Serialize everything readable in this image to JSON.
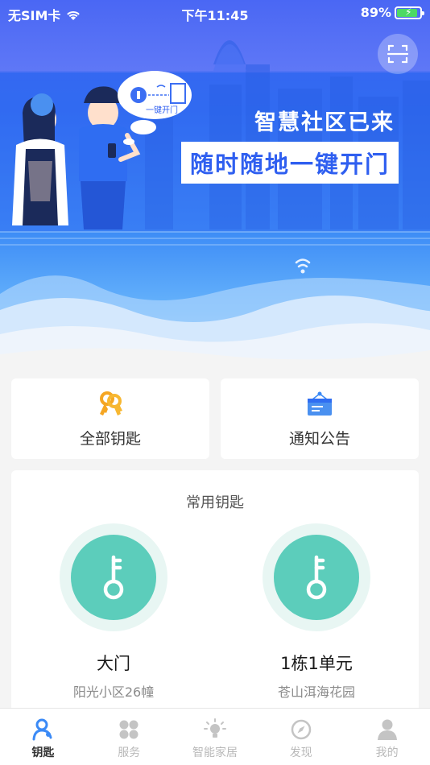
{
  "status_bar": {
    "carrier": "无SIM卡",
    "time": "下午11:45",
    "battery": "89%",
    "battery_level": 0.89
  },
  "hero": {
    "slogan_line1": "智慧社区已来",
    "slogan_line2": "随时随地一键开门",
    "bubble_text": "一键开门",
    "scan_icon": "scan-icon"
  },
  "quick_actions": [
    {
      "label": "全部钥匙",
      "icon": "keys-icon"
    },
    {
      "label": "通知公告",
      "icon": "notice-board-icon"
    }
  ],
  "common_keys": {
    "title": "常用钥匙",
    "items": [
      {
        "name": "大门",
        "community": "阳光小区26幢",
        "icon": "key-icon"
      },
      {
        "name": "1栋1单元",
        "community": "苍山洱海花园",
        "icon": "key-icon"
      }
    ]
  },
  "tabs": [
    {
      "label": "钥匙",
      "icon": "key-person-icon",
      "active": true
    },
    {
      "label": "服务",
      "icon": "grid-icon",
      "active": false
    },
    {
      "label": "智能家居",
      "icon": "lightbulb-icon",
      "active": false
    },
    {
      "label": "发现",
      "icon": "compass-icon",
      "active": false
    },
    {
      "label": "我的",
      "icon": "user-icon",
      "active": false
    }
  ],
  "colors": {
    "primary": "#3b6ef3",
    "key_green": "#5ccdbb",
    "key_ring": "#e8f6f3",
    "tab_active": "#3b8af6",
    "tab_inactive": "#c4c4c4"
  }
}
